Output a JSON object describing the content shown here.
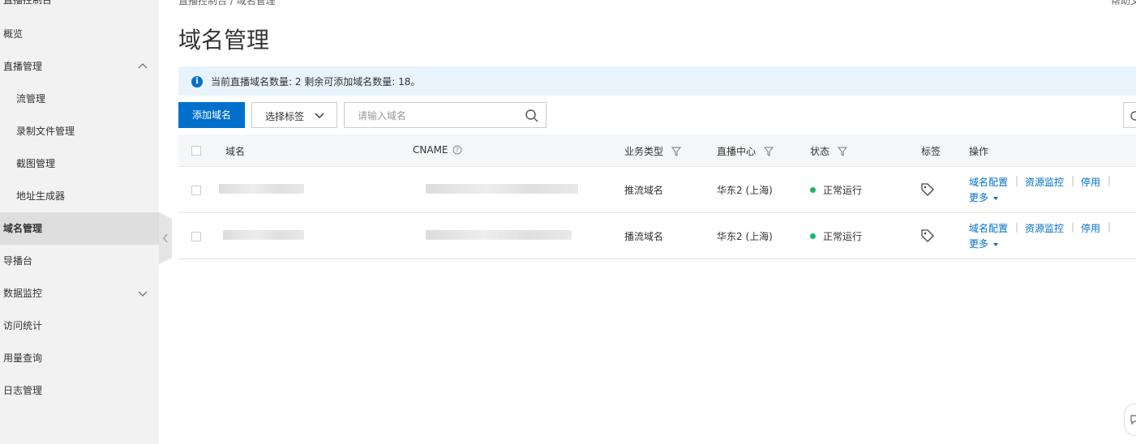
{
  "sidebar": {
    "console_title": "直播控制台",
    "items": [
      {
        "label": "概览"
      },
      {
        "label": "直播管理"
      },
      {
        "label": "流管理"
      },
      {
        "label": "录制文件管理"
      },
      {
        "label": "截图管理"
      },
      {
        "label": "地址生成器"
      },
      {
        "label": "域名管理"
      },
      {
        "label": "导播台"
      },
      {
        "label": "数据监控"
      },
      {
        "label": "访问统计"
      },
      {
        "label": "用量查询"
      },
      {
        "label": "日志管理"
      }
    ]
  },
  "header": {
    "breadcrumb": "直播控制台  /  域名管理",
    "help": "帮助文档",
    "page_title": "域名管理"
  },
  "notice": {
    "text": "当前直播域名数量: 2 剩余可添加域名数量: 18。"
  },
  "toolbar": {
    "add_label": "添加域名",
    "tag_select_label": "选择标签",
    "search_placeholder": "请输入域名"
  },
  "table": {
    "columns": {
      "domain": "域名",
      "cname": "CNAME",
      "type": "业务类型",
      "center": "直播中心",
      "status": "状态",
      "tag": "标签",
      "actions": "操作"
    },
    "rows": [
      {
        "type": "推流域名",
        "center": "华东2 (上海)",
        "status": "正常运行"
      },
      {
        "type": "播流域名",
        "center": "华东2 (上海)",
        "status": "正常运行"
      }
    ],
    "actions": {
      "config": "域名配置",
      "monitor": "资源监控",
      "disable": "停用",
      "more": "更多",
      "sep": "|"
    }
  },
  "colors": {
    "primary": "#0070cc",
    "status_ok": "#1ab56a",
    "notice_bg": "#e8f3fb",
    "sidebar_bg": "#f2f2f2"
  }
}
